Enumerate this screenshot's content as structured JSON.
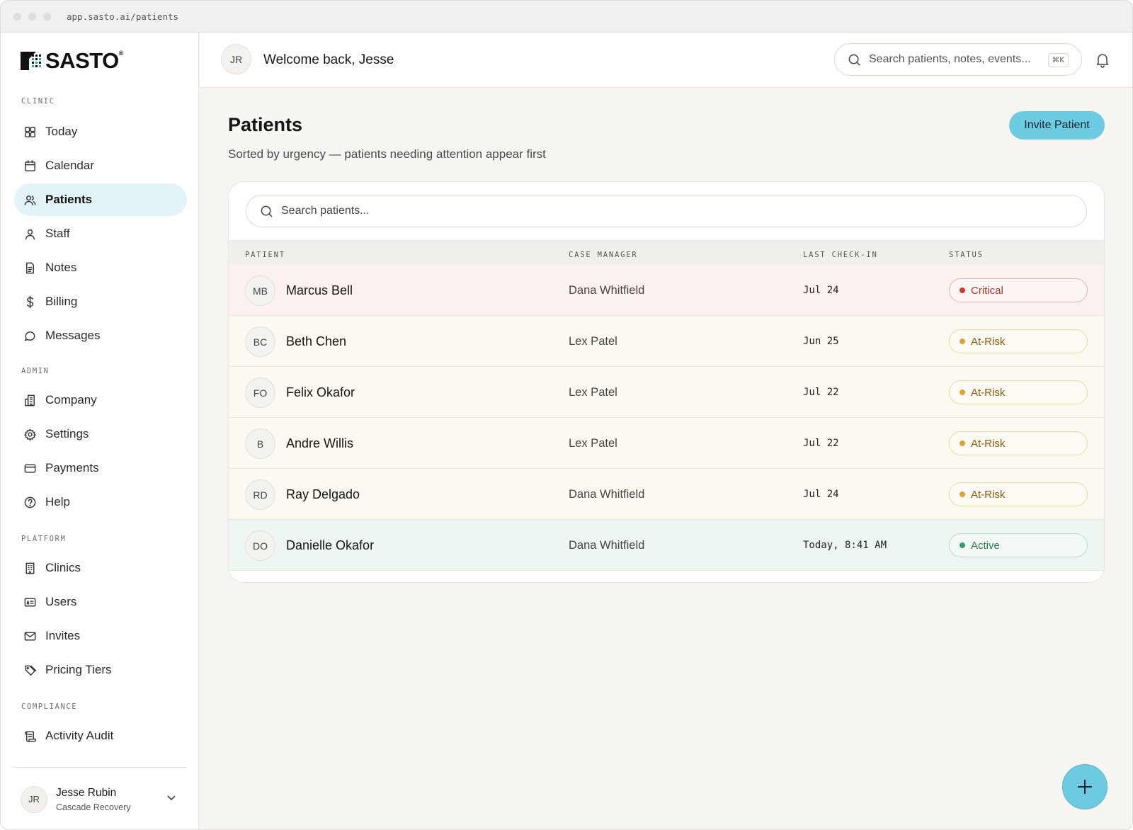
{
  "browser": {
    "url": "app.sasto.ai/patients"
  },
  "brand": {
    "name": "SASTO",
    "reg": "®"
  },
  "sidebar": {
    "sections": [
      {
        "label": "CLINIC",
        "items": [
          {
            "label": "Today",
            "icon": "grid-icon"
          },
          {
            "label": "Calendar",
            "icon": "calendar-icon"
          },
          {
            "label": "Patients",
            "icon": "users-icon",
            "active": true
          },
          {
            "label": "Staff",
            "icon": "user-icon"
          },
          {
            "label": "Notes",
            "icon": "document-icon"
          },
          {
            "label": "Billing",
            "icon": "dollar-icon"
          },
          {
            "label": "Messages",
            "icon": "chat-icon"
          }
        ]
      },
      {
        "label": "ADMIN",
        "items": [
          {
            "label": "Company",
            "icon": "building-icon"
          },
          {
            "label": "Settings",
            "icon": "gear-icon"
          },
          {
            "label": "Payments",
            "icon": "card-icon"
          },
          {
            "label": "Help",
            "icon": "help-icon"
          }
        ]
      },
      {
        "label": "PLATFORM",
        "items": [
          {
            "label": "Clinics",
            "icon": "office-icon"
          },
          {
            "label": "Users",
            "icon": "id-card-icon"
          },
          {
            "label": "Invites",
            "icon": "mail-icon"
          },
          {
            "label": "Pricing Tiers",
            "icon": "tag-icon"
          }
        ]
      },
      {
        "label": "COMPLIANCE",
        "items": [
          {
            "label": "Activity Audit",
            "icon": "scroll-icon"
          }
        ]
      }
    ],
    "user": {
      "initials": "JR",
      "name": "Jesse Rubin",
      "org": "Cascade Recovery"
    }
  },
  "header": {
    "avatar_initials": "JR",
    "welcome": "Welcome back, Jesse",
    "search_placeholder": "Search patients, notes, events...",
    "shortcut": "⌘K"
  },
  "main": {
    "title": "Patients",
    "subtitle": "Sorted by urgency — patients needing attention appear first",
    "invite_label": "Invite Patient",
    "table_search_placeholder": "Search patients...",
    "columns": [
      "PATIENT",
      "CASE MANAGER",
      "LAST CHECK-IN",
      "STATUS"
    ],
    "rows": [
      {
        "initials": "MB",
        "name": "Marcus Bell",
        "manager": "Dana Whitfield",
        "checkin": "Jul 24",
        "status": "Critical",
        "level": "critical"
      },
      {
        "initials": "BC",
        "name": "Beth Chen",
        "manager": "Lex Patel",
        "checkin": "Jun 25",
        "status": "At-Risk",
        "level": "atrisk"
      },
      {
        "initials": "FO",
        "name": "Felix Okafor",
        "manager": "Lex Patel",
        "checkin": "Jul 22",
        "status": "At-Risk",
        "level": "atrisk"
      },
      {
        "initials": "B",
        "name": "Andre Willis",
        "manager": "Lex Patel",
        "checkin": "Jul 22",
        "status": "At-Risk",
        "level": "atrisk"
      },
      {
        "initials": "RD",
        "name": "Ray Delgado",
        "manager": "Dana Whitfield",
        "checkin": "Jul 24",
        "status": "At-Risk",
        "level": "atrisk"
      },
      {
        "initials": "DO",
        "name": "Danielle Okafor",
        "manager": "Dana Whitfield",
        "checkin": "Today, 8:41 AM",
        "status": "Active",
        "level": "active"
      }
    ]
  },
  "colors": {
    "accent": "#6ccbe0",
    "critical": "#d23b2b",
    "atrisk": "#e0a52e",
    "active": "#3a9b68"
  }
}
